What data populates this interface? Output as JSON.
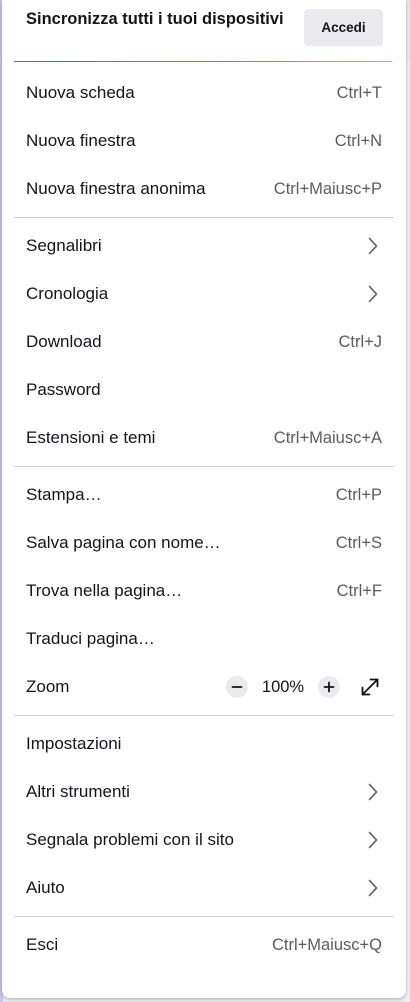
{
  "header": {
    "title": "Sincronizza tutti i tuoi dispositivi",
    "signin_label": "Accedi"
  },
  "group1": [
    {
      "label": "Nuova scheda",
      "shortcut": "Ctrl+T"
    },
    {
      "label": "Nuova finestra",
      "shortcut": "Ctrl+N"
    },
    {
      "label": "Nuova finestra anonima",
      "shortcut": "Ctrl+Maiusc+P"
    }
  ],
  "group2": [
    {
      "label": "Segnalibri",
      "submenu": true
    },
    {
      "label": "Cronologia",
      "submenu": true
    },
    {
      "label": "Download",
      "shortcut": "Ctrl+J"
    },
    {
      "label": "Password"
    },
    {
      "label": "Estensioni e temi",
      "shortcut": "Ctrl+Maiusc+A"
    }
  ],
  "group3": [
    {
      "label": "Stampa…",
      "shortcut": "Ctrl+P"
    },
    {
      "label": "Salva pagina con nome…",
      "shortcut": "Ctrl+S"
    },
    {
      "label": "Trova nella pagina…",
      "shortcut": "Ctrl+F"
    },
    {
      "label": "Traduci pagina…"
    }
  ],
  "zoom": {
    "label": "Zoom",
    "value": "100%",
    "minus": "−",
    "plus": "+",
    "fullscreen_icon": "fullscreen-expand-icon"
  },
  "group4": [
    {
      "label": "Impostazioni"
    },
    {
      "label": "Altri strumenti",
      "submenu": true
    },
    {
      "label": "Segnala problemi con il sito",
      "submenu": true
    },
    {
      "label": "Aiuto",
      "submenu": true
    }
  ],
  "exit": {
    "label": "Esci",
    "shortcut": "Ctrl+Maiusc+Q"
  },
  "colors": {
    "accent_gradient": [
      "#7b4fd6",
      "#d94fa5",
      "#f5a623"
    ],
    "button_bg": "#ebebef"
  }
}
